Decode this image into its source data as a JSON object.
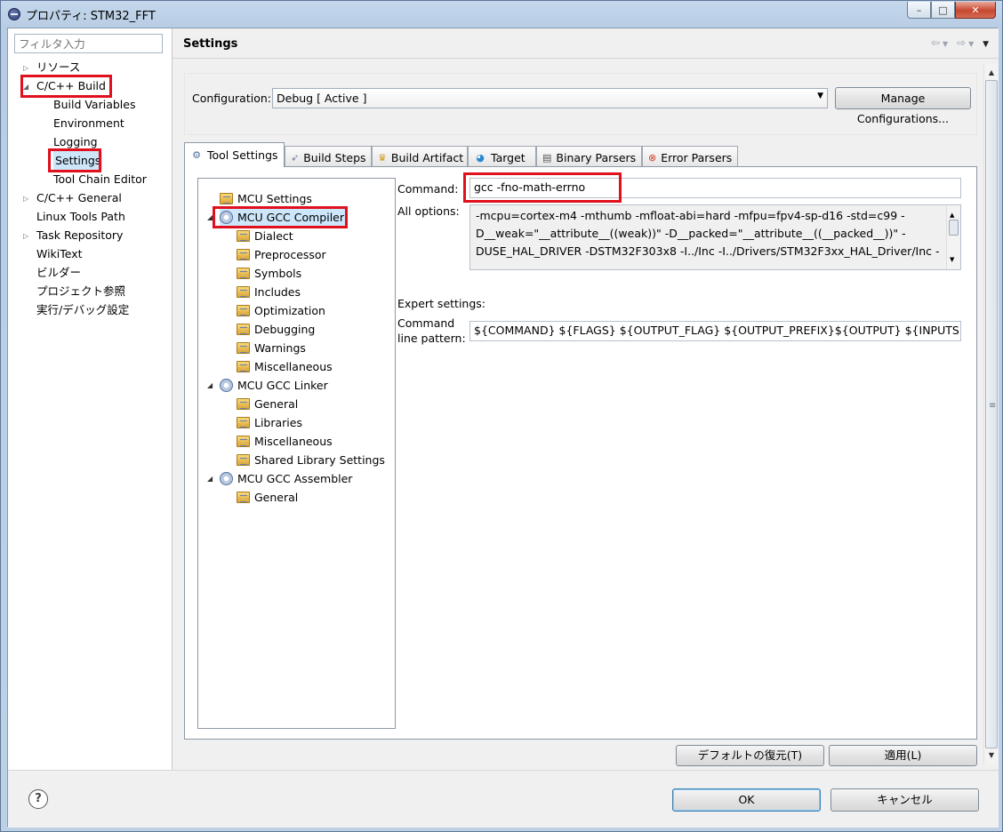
{
  "window": {
    "title": "プロパティ: STM32_FFT",
    "controls": {
      "minimize": "–",
      "maximize": "□",
      "close": "✕"
    }
  },
  "leftnav": {
    "filter_placeholder": "フィルタ入力",
    "items": [
      {
        "label": "リソース",
        "expander": "collapsed"
      },
      {
        "label": "C/C++ Build",
        "expander": "expanded"
      },
      {
        "label": "Build Variables"
      },
      {
        "label": "Environment"
      },
      {
        "label": "Logging"
      },
      {
        "label": "Settings"
      },
      {
        "label": "Tool Chain Editor"
      },
      {
        "label": "C/C++ General",
        "expander": "collapsed"
      },
      {
        "label": "Linux Tools Path"
      },
      {
        "label": "Task Repository",
        "expander": "collapsed"
      },
      {
        "label": "WikiText"
      },
      {
        "label": "ビルダー"
      },
      {
        "label": "プロジェクト参照"
      },
      {
        "label": "実行/デバッグ設定"
      }
    ]
  },
  "header": {
    "title": "Settings"
  },
  "configuration": {
    "label": "Configuration:",
    "value": "Debug  [ Active ]",
    "manage_button": "Manage Configurations..."
  },
  "tabs": [
    {
      "label": "Tool Settings",
      "icon": "tool-settings-icon"
    },
    {
      "label": "Build Steps",
      "icon": "build-steps-icon"
    },
    {
      "label": "Build Artifact",
      "icon": "build-artifact-icon"
    },
    {
      "label": "Target",
      "icon": "target-icon"
    },
    {
      "label": "Binary Parsers",
      "icon": "binary-parsers-icon"
    },
    {
      "label": "Error Parsers",
      "icon": "error-parsers-icon"
    }
  ],
  "tree": [
    {
      "label": "MCU Settings"
    },
    {
      "label": "MCU GCC Compiler"
    },
    {
      "label": "Dialect"
    },
    {
      "label": "Preprocessor"
    },
    {
      "label": "Symbols"
    },
    {
      "label": "Includes"
    },
    {
      "label": "Optimization"
    },
    {
      "label": "Debugging"
    },
    {
      "label": "Warnings"
    },
    {
      "label": "Miscellaneous"
    },
    {
      "label": "MCU GCC Linker"
    },
    {
      "label": "General"
    },
    {
      "label": "Libraries"
    },
    {
      "label": "Miscellaneous"
    },
    {
      "label": "Shared Library Settings"
    },
    {
      "label": "MCU GCC Assembler"
    },
    {
      "label": "General"
    }
  ],
  "form": {
    "command_label": "Command:",
    "command_value": "gcc -fno-math-errno",
    "alloptions_label": "All options:",
    "alloptions_lines": [
      "-mcpu=cortex-m4 -mthumb -mfloat-abi=hard -mfpu=fpv4-sp-d16 -std=c99 -",
      "D__weak=\"__attribute__((weak))\" -D__packed=\"__attribute__((__packed__))\" -",
      "DUSE_HAL_DRIVER -DSTM32F303x8 -I../Inc -I../Drivers/STM32F3xx_HAL_Driver/Inc -"
    ],
    "expert_label": "Expert settings:",
    "pattern_label_1": "Command",
    "pattern_label_2": "line pattern:",
    "pattern_value": "${COMMAND} ${FLAGS} ${OUTPUT_FLAG} ${OUTPUT_PREFIX}${OUTPUT} ${INPUTS}"
  },
  "buttons": {
    "restore_defaults": "デフォルトの復元(T)",
    "apply": "適用(L)",
    "ok": "OK",
    "cancel": "キャンセル"
  },
  "colors": {
    "highlight_box": "#e0101d",
    "selection": "#cde6fa"
  }
}
